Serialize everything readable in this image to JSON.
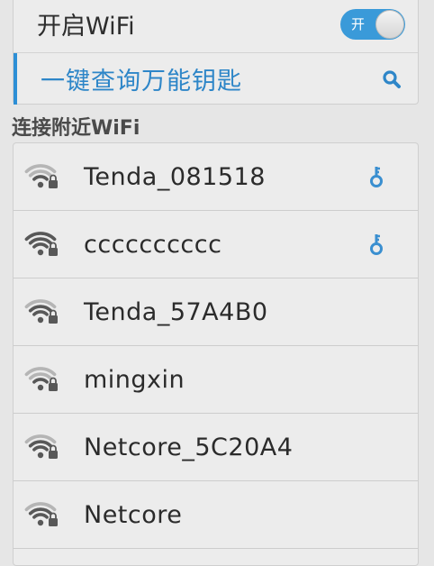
{
  "wifi_switch": {
    "label": "开启WiFi",
    "state_text": "开",
    "on": true
  },
  "query": {
    "label": "一键查询万能钥匙",
    "icon": "search-icon"
  },
  "section": {
    "title": "连接附近WiFi"
  },
  "networks": [
    {
      "name": "Tenda_081518",
      "key": true,
      "signal": "weak"
    },
    {
      "name": "cccccccccc",
      "key": true,
      "signal": "strong"
    },
    {
      "name": "Tenda_57A4B0",
      "key": false,
      "signal": "medium"
    },
    {
      "name": "mingxin",
      "key": false,
      "signal": "weak"
    },
    {
      "name": "Netcore_5C20A4",
      "key": false,
      "signal": "medium"
    },
    {
      "name": "Netcore",
      "key": false,
      "signal": "medium"
    }
  ],
  "colors": {
    "accent": "#2e86c8",
    "switch_on": "#3a9ad9",
    "key": "#3a8fd0",
    "wifi_strong": "#585858",
    "wifi_weak": "#b5b5b5"
  }
}
